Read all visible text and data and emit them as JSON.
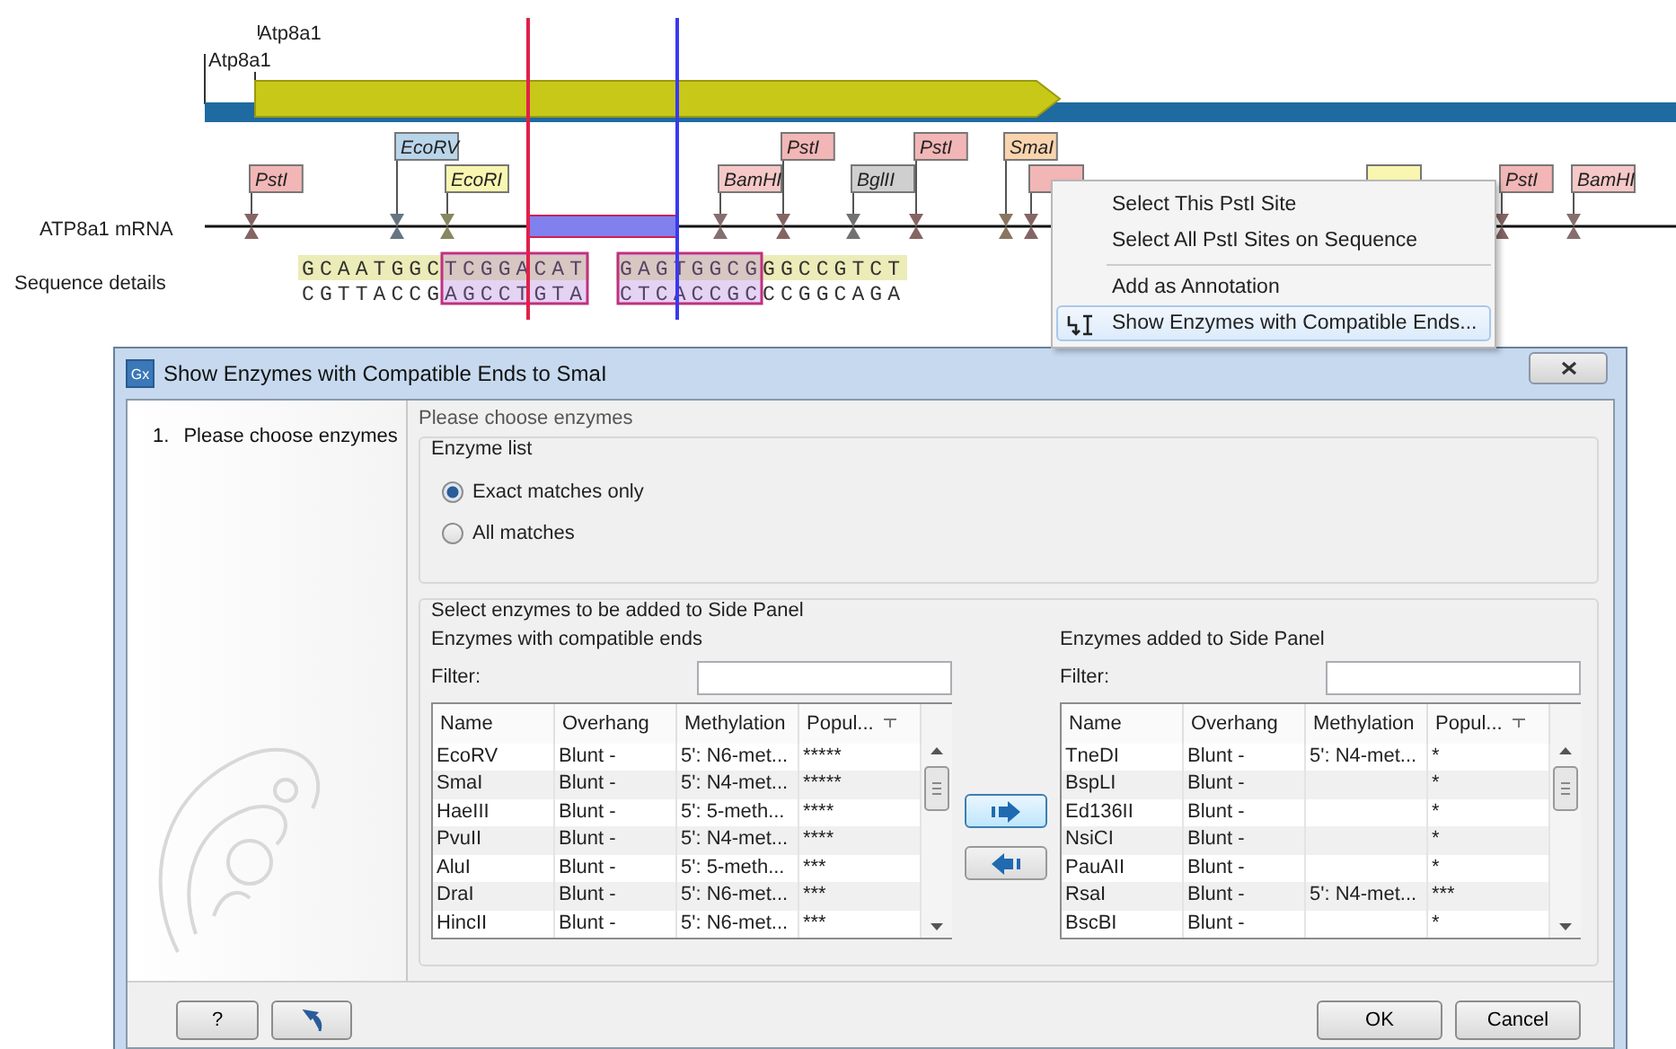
{
  "map": {
    "genes": [
      {
        "label": "Atp8a1"
      },
      {
        "label": "Atp8a1"
      }
    ],
    "track_label": "ATP8a1 mRNA",
    "sequence_label": "Sequence details",
    "sites": [
      {
        "name": "PstI",
        "color": "#f2b6b6"
      },
      {
        "name": "EcoRV",
        "color": "#b9d5ea"
      },
      {
        "name": "EcoRI",
        "color": "#f8f6b0"
      },
      {
        "name": "BamHI",
        "color": "#f6c8c8"
      },
      {
        "name": "PstI",
        "color": "#f2b6b6"
      },
      {
        "name": "BglII",
        "color": "#cfcfcf"
      },
      {
        "name": "PstI",
        "color": "#f2b6b6"
      },
      {
        "name": "SmaI",
        "color": "#f9d4ae"
      },
      {
        "color": "#f2b6b6"
      },
      {
        "color": "#f8f6b0"
      },
      {
        "name": "PstI",
        "color": "#f2b6b6"
      },
      {
        "name": "BamHI",
        "color": "#f6c8c8"
      }
    ],
    "sequence": [
      {
        "top": "GCAATGGCTCGGACAT",
        "bottom": "CGTTACCGAGCCTGTA"
      },
      {
        "top": "GAGTGGCGGGCCGTCT",
        "bottom": "CTCACCGCCCGGCAGA"
      }
    ]
  },
  "context_menu": {
    "items": [
      {
        "kind": "item",
        "label": "Select This PstI Site",
        "selected": false
      },
      {
        "kind": "item",
        "label": "Select All PstI Sites on Sequence",
        "selected": false
      },
      {
        "kind": "separator"
      },
      {
        "kind": "item",
        "label": "Add as Annotation",
        "selected": false
      },
      {
        "kind": "item",
        "label": "Show Enzymes with Compatible Ends...",
        "selected": true,
        "icon": true
      }
    ]
  },
  "dialog": {
    "title": "Show Enzymes with Compatible Ends to SmaI",
    "app_icon": "Gx",
    "steps": [
      {
        "number": "1.",
        "label": "Please choose enzymes",
        "selected": true
      }
    ],
    "heading": "Please choose enzymes",
    "enzyme_list": {
      "title": "Enzyme list",
      "options": [
        {
          "label": "Exact matches only",
          "selected": true
        },
        {
          "label": "All matches",
          "selected": false
        }
      ]
    },
    "side_panel": {
      "title": "Select enzymes to be added to Side Panel",
      "left": {
        "title": "Enzymes with compatible ends",
        "filter_label": "Filter:",
        "columns": [
          "Name",
          "Overhang",
          "Methylation",
          "Popul..."
        ],
        "rows": [
          [
            "EcoRV",
            "Blunt -",
            "5': N6-met...",
            "*****"
          ],
          [
            "SmaI",
            "Blunt -",
            "5': N4-met...",
            "*****"
          ],
          [
            "HaeIII",
            "Blunt -",
            "5': 5-meth...",
            "****"
          ],
          [
            "PvuII",
            "Blunt -",
            "5': N4-met...",
            "****"
          ],
          [
            "AluI",
            "Blunt -",
            "5': 5-meth...",
            "***"
          ],
          [
            "DraI",
            "Blunt -",
            "5': N6-met...",
            "***"
          ],
          [
            "HincII",
            "Blunt -",
            "5': N6-met...",
            "***"
          ]
        ]
      },
      "right": {
        "title": "Enzymes added to Side Panel",
        "filter_label": "Filter:",
        "columns": [
          "Name",
          "Overhang",
          "Methylation",
          "Popul..."
        ],
        "rows": [
          [
            "TneDI",
            "Blunt -",
            "5': N4-met...",
            "*"
          ],
          [
            "BspLI",
            "Blunt -",
            "",
            "*"
          ],
          [
            "Ed136II",
            "Blunt -",
            "",
            "*"
          ],
          [
            "NsiCI",
            "Blunt -",
            "",
            "*"
          ],
          [
            "PauAII",
            "Blunt -",
            "",
            "*"
          ],
          [
            "RsaI",
            "Blunt -",
            "5': N4-met...",
            "***"
          ],
          [
            "BscBI",
            "Blunt -",
            "",
            "*"
          ]
        ]
      }
    },
    "footer": {
      "help": "?",
      "ok": "OK",
      "cancel": "Cancel"
    }
  }
}
